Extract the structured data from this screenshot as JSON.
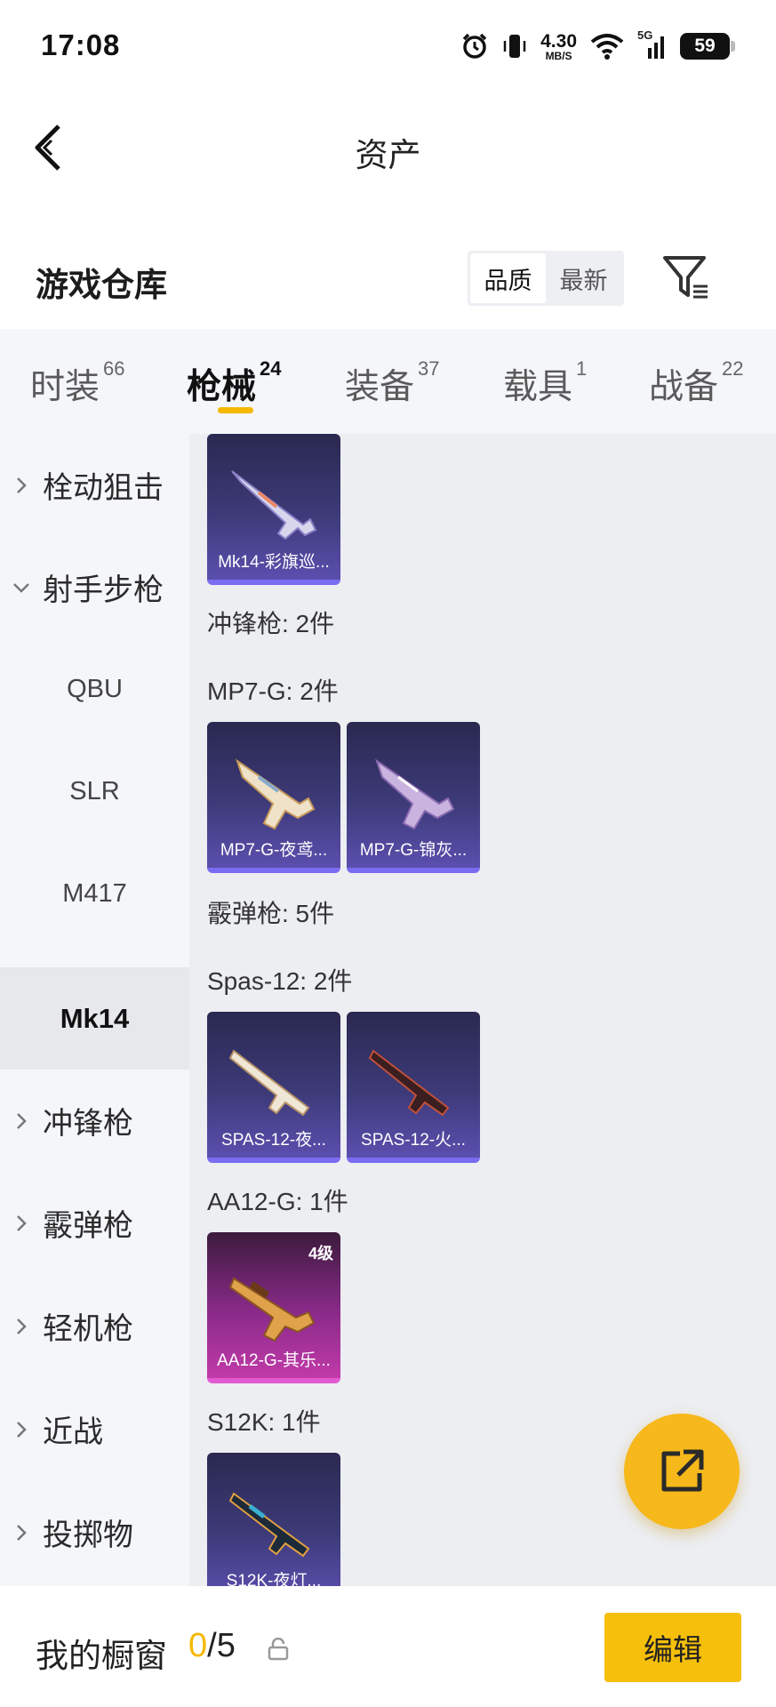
{
  "status_bar": {
    "time": "17:08",
    "net_speed_value": "4.30",
    "net_speed_unit": "MB/S",
    "signal_label": "5G",
    "battery": "59"
  },
  "header": {
    "title": "资产"
  },
  "warehouse": {
    "title": "游戏仓库",
    "sort_options": [
      "品质",
      "最新"
    ],
    "sort_selected": "品质"
  },
  "tabs": [
    {
      "label": "时装",
      "count": "66"
    },
    {
      "label": "枪械",
      "count": "24"
    },
    {
      "label": "装备",
      "count": "37"
    },
    {
      "label": "载具",
      "count": "1"
    },
    {
      "label": "战备",
      "count": "22"
    }
  ],
  "active_tab": "枪械",
  "sidebar": {
    "items": [
      {
        "label": "栓动狙击",
        "type": "category",
        "expanded": false
      },
      {
        "label": "射手步枪",
        "type": "category",
        "expanded": true
      },
      {
        "label": "QBU",
        "type": "sub"
      },
      {
        "label": "SLR",
        "type": "sub"
      },
      {
        "label": "M417",
        "type": "sub"
      },
      {
        "label": "Mk14",
        "type": "sub",
        "selected": true
      },
      {
        "label": "冲锋枪",
        "type": "category",
        "expanded": false
      },
      {
        "label": "霰弹枪",
        "type": "category",
        "expanded": false
      },
      {
        "label": "轻机枪",
        "type": "category",
        "expanded": false
      },
      {
        "label": "近战",
        "type": "category",
        "expanded": false
      },
      {
        "label": "投掷物",
        "type": "category",
        "expanded": false
      }
    ]
  },
  "content": {
    "top_card": {
      "name": "Mk14-彩旗巡..."
    },
    "smg_section": "冲锋枪: 2件",
    "mp7_section": "MP7-G: 2件",
    "mp7_cards": [
      {
        "name": "MP7-G-夜鸢..."
      },
      {
        "name": "MP7-G-锦灰..."
      }
    ],
    "shotgun_section": "霰弹枪: 5件",
    "spas_section": "Spas-12: 2件",
    "spas_cards": [
      {
        "name": "SPAS-12-夜..."
      },
      {
        "name": "SPAS-12-火..."
      }
    ],
    "aa12_section": "AA12-G: 1件",
    "aa12_card": {
      "name": "AA12-G-其乐...",
      "level": "4级"
    },
    "s12k_section": "S12K: 1件",
    "s12k_card": {
      "name": "S12K-夜灯..."
    }
  },
  "bottom": {
    "showcase_label": "我的橱窗",
    "showcase_current": "0",
    "showcase_total": "/5",
    "edit_label": "编辑"
  },
  "colors": {
    "accent": "#f5b800",
    "card_purple": "#3d3a78",
    "card_legend": "#c13aa8"
  },
  "icons": [
    "back-arrow-icon",
    "filter-icon",
    "share-icon",
    "lock-icon",
    "chevron-right-icon",
    "chevron-down-icon",
    "alarm-icon",
    "vibrate-icon",
    "wifi-icon",
    "signal-icon",
    "battery-icon"
  ]
}
